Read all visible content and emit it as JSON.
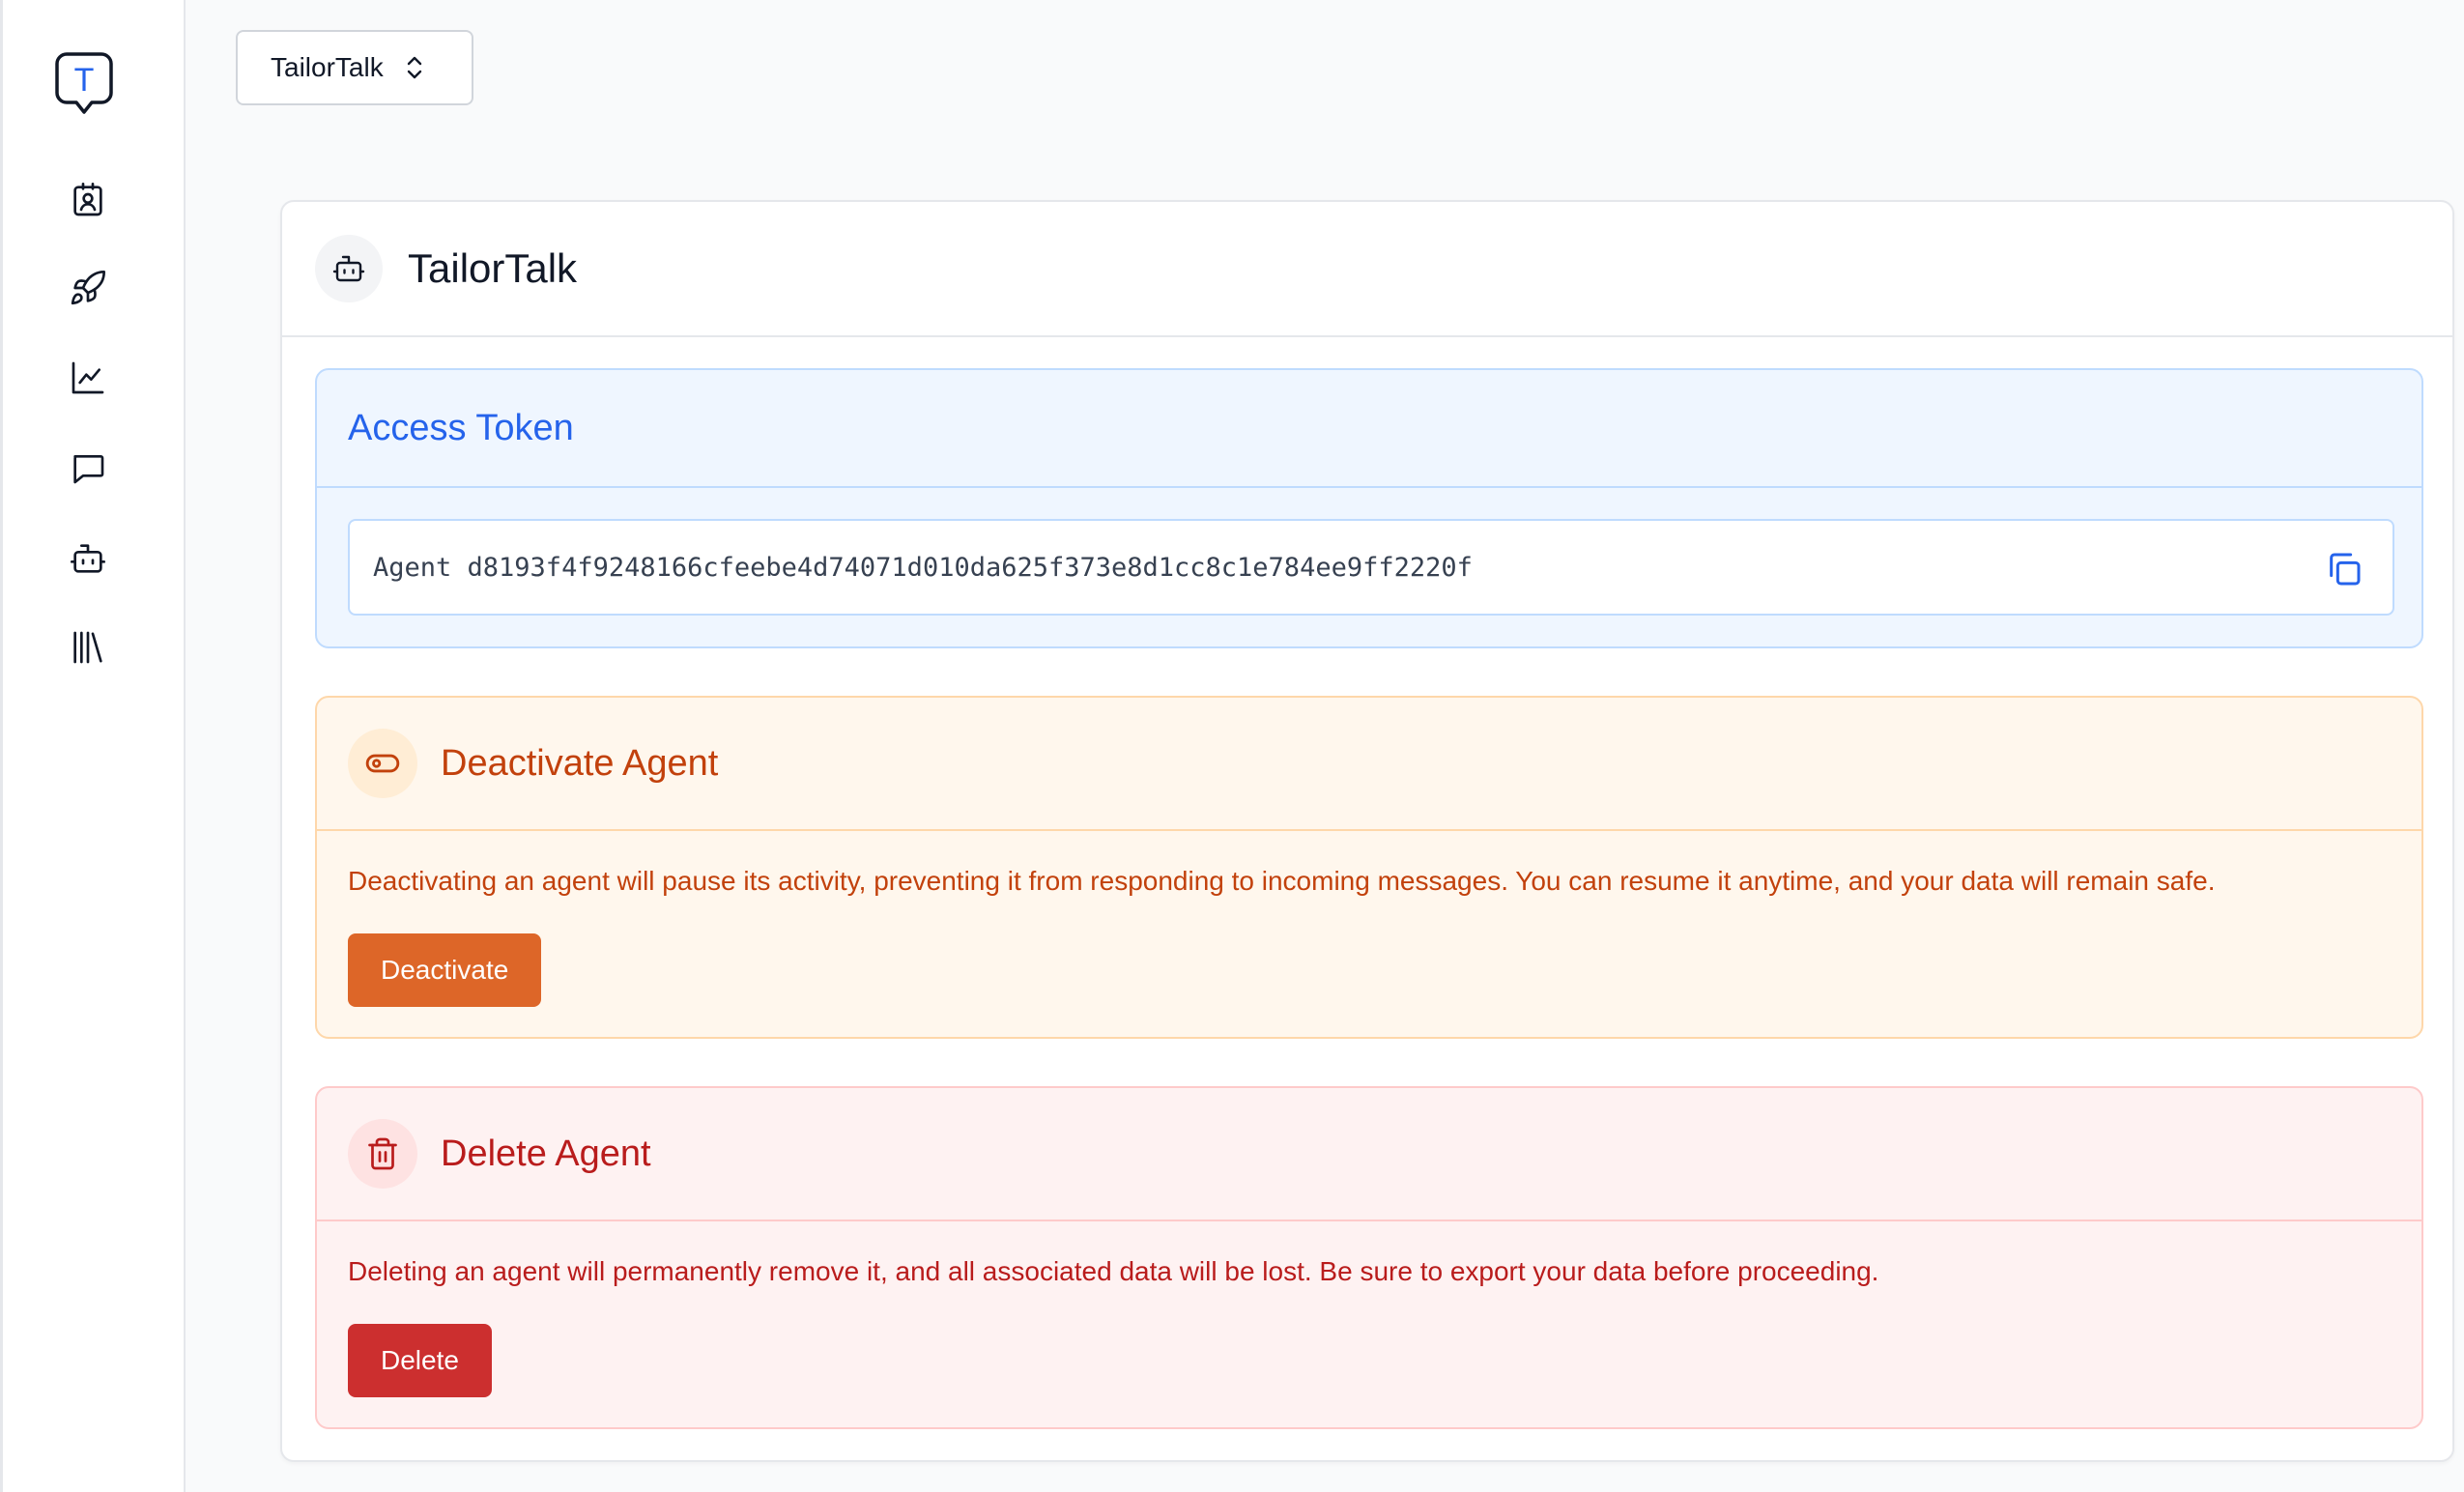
{
  "sidebar": {
    "logo_letter": "T",
    "items": [
      {
        "name": "contacts",
        "icon": "contact-card-icon"
      },
      {
        "name": "campaigns",
        "icon": "rocket-icon"
      },
      {
        "name": "analytics",
        "icon": "line-chart-icon"
      },
      {
        "name": "conversations",
        "icon": "chat-bubble-icon"
      },
      {
        "name": "agents",
        "icon": "bot-icon"
      },
      {
        "name": "library",
        "icon": "library-icon"
      }
    ]
  },
  "workspace_selector": {
    "value": "TailorTalk",
    "icon": "chevron-up-down-icon"
  },
  "agent_card": {
    "title": "TailorTalk",
    "icon": "bot-icon"
  },
  "access_token": {
    "title": "Access Token",
    "value": "Agent d8193f4f9248166cfeebe4d74071d010da625f373e8d1cc8c1e784ee9ff2220f",
    "copy_icon": "copy-icon"
  },
  "deactivate": {
    "title": "Deactivate Agent",
    "icon": "toggle-icon",
    "description": "Deactivating an agent will pause its activity, preventing it from responding to incoming messages. You can resume it anytime, and your data will remain safe.",
    "button_label": "Deactivate"
  },
  "delete": {
    "title": "Delete Agent",
    "icon": "trash-icon",
    "description": "Deleting an agent will permanently remove it, and all associated data will be lost. Be sure to export your data before proceeding.",
    "button_label": "Delete"
  },
  "colors": {
    "accent_blue": "#2563eb",
    "warning_orange": "#dd6628",
    "danger_red": "#cc2f2f"
  }
}
